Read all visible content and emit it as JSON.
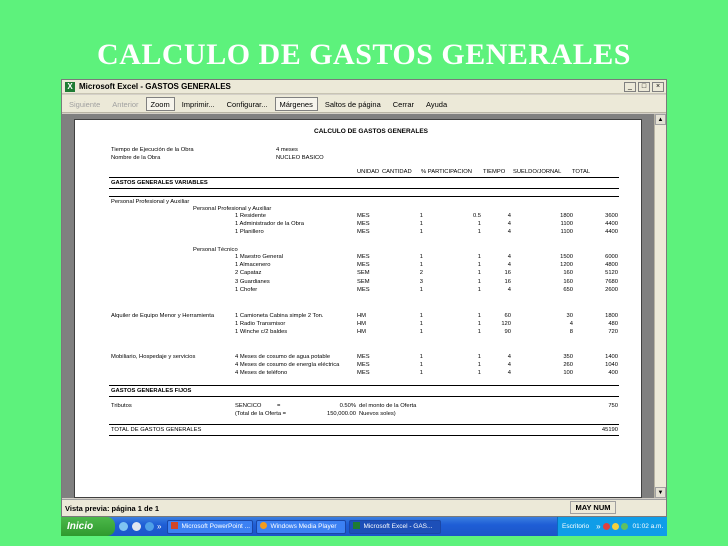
{
  "slide": {
    "title": "CALCULO DE GASTOS GENERALES"
  },
  "window": {
    "title": "Microsoft Excel - GASTOS GENERALES",
    "icon_label": "X",
    "buttons": {
      "minimize": "_",
      "maximize": "□",
      "close": "×"
    }
  },
  "toolbar": {
    "siguiente": "Siguiente",
    "anterior": "Anterior",
    "zoom": "Zoom",
    "imprimir": "Imprimir...",
    "configurar": "Configurar...",
    "margenes": "Márgenes",
    "saltos": "Saltos de página",
    "cerrar": "Cerrar",
    "ayuda": "Ayuda"
  },
  "sheet": {
    "title": "CALCULO DE GASTOS GENERALES",
    "meta": [
      {
        "label": "Tiempo de Ejecución de la Obra",
        "value": "4 meses"
      },
      {
        "label": "Nombre de la Obra",
        "value": "NUCLEO BASICO"
      }
    ],
    "headers": [
      "UNIDAD",
      "CANTIDAD",
      "% PARTICIPACION",
      "TIEMPO",
      "SUELDO/JORNAL",
      "TOTAL"
    ],
    "variables_title": "GASTOS GENERALES VARIABLES",
    "personal_group": "Personal Profesional y Auxiliar",
    "personal_sub": "Personal Profesional y Auxiliar",
    "personal_rows": [
      [
        "1 Residente",
        "MES",
        "1",
        "0.5",
        "4",
        "1800",
        "3600"
      ],
      [
        "1 Administrador de la Obra",
        "MES",
        "1",
        "1",
        "4",
        "1100",
        "4400"
      ],
      [
        "1 Planillero",
        "MES",
        "1",
        "1",
        "4",
        "1100",
        "4400"
      ]
    ],
    "tecnico_sub": "Personal Técnico",
    "tecnico_rows": [
      [
        "1 Maestro General",
        "MES",
        "1",
        "1",
        "4",
        "1500",
        "6000"
      ],
      [
        "1 Almacenero",
        "MES",
        "1",
        "1",
        "4",
        "1200",
        "4800"
      ],
      [
        "2 Capataz",
        "SEM",
        "2",
        "1",
        "16",
        "160",
        "5120"
      ],
      [
        "3 Guardianes",
        "SEM",
        "3",
        "1",
        "16",
        "160",
        "7680"
      ],
      [
        "1 Chofer",
        "MES",
        "1",
        "1",
        "4",
        "650",
        "2600"
      ]
    ],
    "equipo_group": "Alquiler de Equipo Menor y Herramienta",
    "equipo_rows": [
      [
        "1 Camioneta Cabina simple 2 Ton.",
        "HM",
        "1",
        "1",
        "60",
        "30",
        "1800"
      ],
      [
        "1 Radio Transmisor",
        "HM",
        "1",
        "1",
        "120",
        "4",
        "480"
      ],
      [
        "1 Winche c/2 baldes",
        "HM",
        "1",
        "1",
        "90",
        "8",
        "720"
      ]
    ],
    "mobiliario_group": "Mobiliario, Hospedaje y servicios",
    "mobiliario_rows": [
      [
        "4 Meses de cosumo de agua potable",
        "MES",
        "1",
        "1",
        "4",
        "350",
        "1400"
      ],
      [
        "4 Meses de cosumo de energía eléctrica",
        "MES",
        "1",
        "1",
        "4",
        "260",
        "1040"
      ],
      [
        "4 Meses de teléfono",
        "MES",
        "1",
        "1",
        "4",
        "100",
        "400"
      ]
    ],
    "fijos_title": "GASTOS GENERALES FIJOS",
    "tributos_label": "Tributos",
    "sencico": "SENCICO",
    "sencico_eq": "=",
    "sencico_pct": "0.50%",
    "sencico_desc": "del monto de la Oferta",
    "sencico_total": "750",
    "oferta_label": "(Total de la Oferta =",
    "oferta_value": "150,000.00",
    "oferta_unit": "Nuevos soles)",
    "total_label": "TOTAL DE GASTOS GENERALES",
    "total_value": "45190"
  },
  "status": {
    "left": "Vista previa: página 1 de 1",
    "mode": "MAY NUM"
  },
  "taskbar": {
    "start": "Inicio",
    "tasks": [
      {
        "label": "Microsoft PowerPoint ...",
        "color": "#d24726"
      },
      {
        "label": "Windows Media Player",
        "color": "#f29b1d"
      },
      {
        "label": "Microsoft Excel - GAS...",
        "color": "#1e7b34"
      }
    ],
    "desktop": "Escritorio",
    "clock": "01:02 a.m."
  }
}
